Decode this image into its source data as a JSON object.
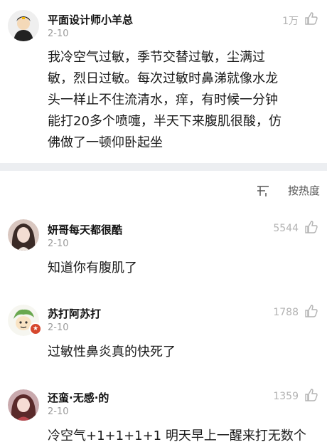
{
  "top_comment": {
    "username": "平面设计师小羊总",
    "date": "2-10",
    "likes": "1万",
    "lines": [
      "我冷空气过敏，季节交替过敏，尘满过",
      "敏，烈日过敏。每次过敏时鼻涕就像水龙",
      "头一样止不住流清水，痒，有时候一分钟",
      "能打20多个喷嚏，半天下来腹肌很酸，仿",
      "佛做了一顿仰卧起坐"
    ]
  },
  "sort": {
    "label": "按热度",
    "icon": "sort-icon"
  },
  "replies": [
    {
      "username": "妍哥每天都很酷",
      "date": "2-10",
      "likes": "5544",
      "text": "知道你有腹肌了"
    },
    {
      "username": "苏打阿苏打",
      "date": "2-10",
      "likes": "1788",
      "text": "过敏性鼻炎真的快死了"
    },
    {
      "username": "还蛮·无感·的",
      "date": "2-10",
      "likes": "1359",
      "text": "冷空气+1+1+1+1 明天早上一醒来打无数个"
    }
  ]
}
